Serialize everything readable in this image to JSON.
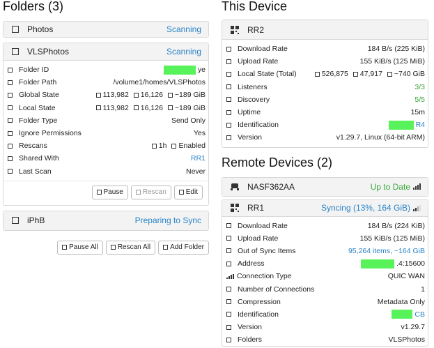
{
  "folders": {
    "heading": "Folders (3)",
    "photos": {
      "title": "Photos",
      "status": "Scanning"
    },
    "vls": {
      "title": "VLSPhotos",
      "status": "Scanning",
      "rows": [
        {
          "label": "Folder ID",
          "value": "ye"
        },
        {
          "label": "Folder Path",
          "value": "/volume1/homes/VLSPhotos"
        },
        {
          "label": "Global State",
          "files": "113,982",
          "dirs": "16,126",
          "size": "~189 GiB"
        },
        {
          "label": "Local State",
          "files": "113,982",
          "dirs": "16,126",
          "size": "~189 GiB"
        },
        {
          "label": "Folder Type",
          "value": "Send Only"
        },
        {
          "label": "Ignore Permissions",
          "value": "Yes"
        },
        {
          "label": "Rescans",
          "interval": "1h",
          "value": "Enabled"
        },
        {
          "label": "Shared With",
          "value": "RR1"
        },
        {
          "label": "Last Scan",
          "value": "Never"
        }
      ],
      "buttons": {
        "pause": "Pause",
        "rescan": "Rescan",
        "edit": "Edit"
      }
    },
    "iphb": {
      "title": "iPhB",
      "status": "Preparing to Sync"
    },
    "buttons": {
      "pause_all": "Pause All",
      "rescan_all": "Rescan All",
      "add_folder": "Add Folder"
    }
  },
  "device": {
    "heading": "This Device",
    "name": "RR2",
    "rows": [
      {
        "label": "Download Rate",
        "value": "184 B/s (225 KiB)"
      },
      {
        "label": "Upload Rate",
        "value": "155 KiB/s (125 MiB)"
      },
      {
        "label": "Local State (Total)",
        "files": "526,875",
        "dirs": "47,917",
        "size": "~740 GiB"
      },
      {
        "label": "Listeners",
        "value": "3/3"
      },
      {
        "label": "Discovery",
        "value": "5/5"
      },
      {
        "label": "Uptime",
        "value": "15m"
      },
      {
        "label": "Identification",
        "value": "R4"
      },
      {
        "label": "Version",
        "value": "v1.29.7, Linux (64-bit ARM)"
      }
    ]
  },
  "remote": {
    "heading": "Remote Devices (2)",
    "nas": {
      "name": "NASF362AA",
      "status": "Up to Date"
    },
    "rr1": {
      "name": "RR1",
      "status": "Syncing (13%, 164 GiB)",
      "rows": [
        {
          "label": "Download Rate",
          "value": "184 B/s (224 KiB)"
        },
        {
          "label": "Upload Rate",
          "value": "155 KiB/s (125 MiB)"
        },
        {
          "label": "Out of Sync Items",
          "value": "95,264 items, ~164 GiB"
        },
        {
          "label": "Address",
          "value": ".4:15600"
        },
        {
          "label": "Connection Type",
          "value": "QUIC WAN"
        },
        {
          "label": "Number of Connections",
          "value": "1"
        },
        {
          "label": "Compression",
          "value": "Metadata Only"
        },
        {
          "label": "Identification",
          "value": "CB"
        },
        {
          "label": "Version",
          "value": "v1.29.7"
        },
        {
          "label": "Folders",
          "value": "VLSPhotos"
        }
      ]
    }
  },
  "colors": {
    "accent": "#2a84c7",
    "success": "#3aa83a",
    "redaction": "#58f25a"
  }
}
